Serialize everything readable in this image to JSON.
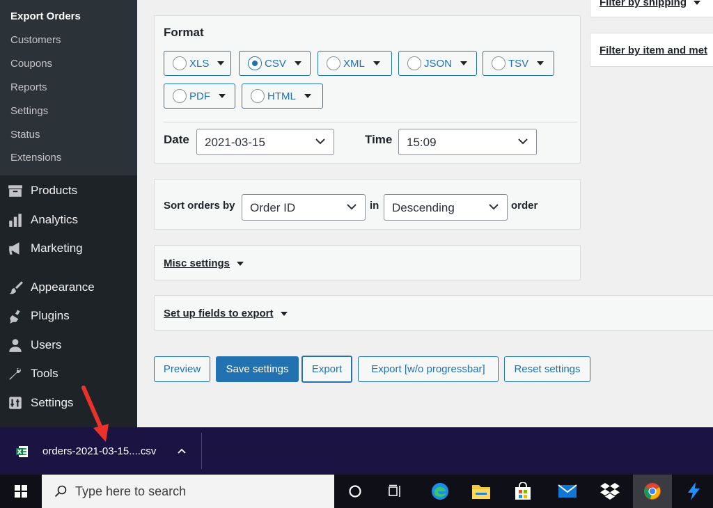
{
  "sidebar": {
    "submenu": [
      "Export Orders",
      "Customers",
      "Coupons",
      "Reports",
      "Settings",
      "Status",
      "Extensions"
    ],
    "menu": [
      {
        "label": "Products",
        "icon": "archive-icon"
      },
      {
        "label": "Analytics",
        "icon": "bar-chart-icon"
      },
      {
        "label": "Marketing",
        "icon": "megaphone-icon"
      },
      {
        "label": "Appearance",
        "icon": "paintbrush-icon"
      },
      {
        "label": "Plugins",
        "icon": "plugin-icon"
      },
      {
        "label": "Users",
        "icon": "user-icon"
      },
      {
        "label": "Tools",
        "icon": "wrench-icon"
      },
      {
        "label": "Settings",
        "icon": "sliders-icon"
      }
    ]
  },
  "filters": {
    "shipping": "Filter by shipping",
    "item_meta": "Filter by item and met"
  },
  "format": {
    "title": "Format",
    "options": [
      "XLS",
      "CSV",
      "XML",
      "JSON",
      "TSV",
      "PDF",
      "HTML"
    ],
    "selected": "CSV",
    "date_label": "Date",
    "date_value": "2021-03-15",
    "time_label": "Time",
    "time_value": "15:09"
  },
  "sort": {
    "label": "Sort orders by",
    "field": "Order ID",
    "in_label": "in",
    "direction": "Descending",
    "order_label": "order"
  },
  "misc": {
    "label": "Misc settings"
  },
  "fields": {
    "label": "Set up fields to export"
  },
  "buttons": {
    "preview": "Preview",
    "save": "Save settings",
    "export": "Export",
    "export_no_progress": "Export [w/o progressbar]",
    "reset": "Reset settings"
  },
  "download": {
    "filename": "orders-2021-03-15....csv"
  },
  "taskbar": {
    "search_placeholder": "Type here to search"
  },
  "colors": {
    "accent": "#2271b1",
    "sidebar": "#1d2327",
    "download_bar": "#1b1342",
    "annotation_arrow": "#e8322a"
  }
}
